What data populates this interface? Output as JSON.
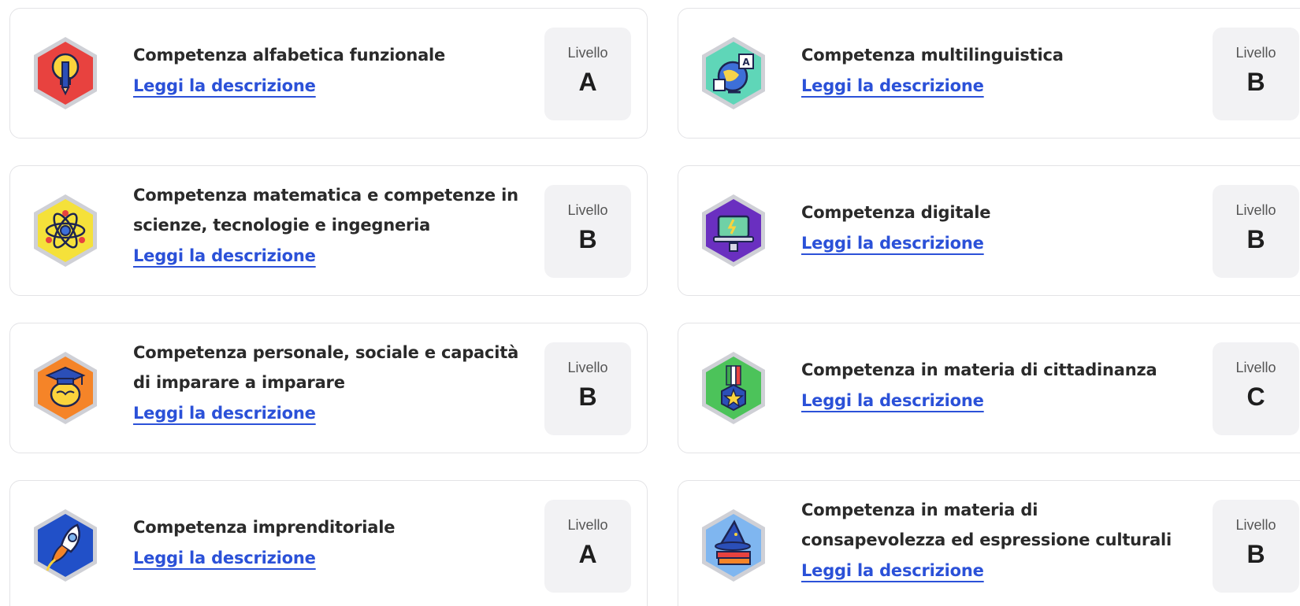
{
  "level_label": "Livello",
  "link_label": "Leggi la descrizione",
  "competences": [
    {
      "title": "Competenza alfabetica funzionale",
      "level": "A",
      "icon": "lightbulb-pen-icon",
      "color": "#e8423f",
      "ring": "#c9c9d0"
    },
    {
      "title": "Competenza multilinguistica",
      "level": "B",
      "icon": "globe-letters-icon",
      "color": "#5fd6b8",
      "ring": "#c9c9d0"
    },
    {
      "title": "Competenza matematica e competenze in scienze, tecnologie e ingegneria",
      "level": "B",
      "icon": "atom-icon",
      "color": "#f5e13a",
      "ring": "#c9c9d0"
    },
    {
      "title": "Competenza digitale",
      "level": "B",
      "icon": "laptop-icon",
      "color": "#6a2fc0",
      "ring": "#c9c9d0"
    },
    {
      "title": "Competenza personale, sociale e capacità di imparare a imparare",
      "level": "B",
      "icon": "graduate-brain-icon",
      "color": "#f58428",
      "ring": "#c9c9d0"
    },
    {
      "title": "Competenza in materia di cittadinanza",
      "level": "C",
      "icon": "medal-icon",
      "color": "#4cc35a",
      "ring": "#c9c9d0"
    },
    {
      "title": "Competenza imprenditoriale",
      "level": "A",
      "icon": "rocket-icon",
      "color": "#2150c8",
      "ring": "#c9c9d0"
    },
    {
      "title": "Competenza in materia di consapevolezza ed espressione culturali",
      "level": "B",
      "icon": "wizard-hat-books-icon",
      "color": "#7fb6f0",
      "ring": "#c9c9d0"
    }
  ]
}
